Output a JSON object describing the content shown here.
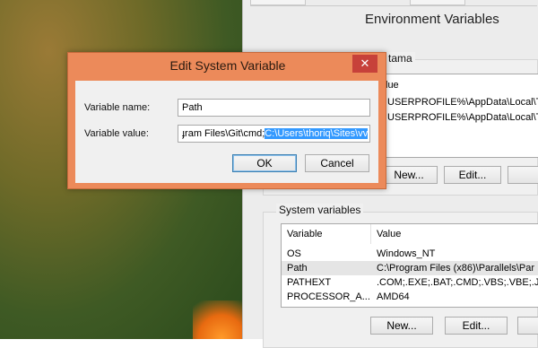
{
  "env_window": {
    "title": "Environment Variables",
    "user_group_label": "tama",
    "user_list": {
      "column_value": "lue",
      "rows": [
        "USERPROFILE%\\AppData\\Local\\Ter",
        "USERPROFILE%\\AppData\\Local\\Ter"
      ]
    },
    "user_buttons": {
      "new": "New...",
      "edit": "Edit...",
      "delete": ""
    },
    "system_group_label": "System variables",
    "system_list": {
      "columns": {
        "variable": "Variable",
        "value": "Value"
      },
      "rows": [
        {
          "variable": "OS",
          "value": "Windows_NT"
        },
        {
          "variable": "Path",
          "value": "C:\\Program Files (x86)\\Parallels\\Par"
        },
        {
          "variable": "PATHEXT",
          "value": ".COM;.EXE;.BAT;.CMD;.VBS;.VBE;.JS"
        },
        {
          "variable": "PROCESSOR_A...",
          "value": "AMD64"
        }
      ]
    },
    "system_buttons": {
      "new": "New...",
      "edit": "Edit...",
      "delete": ""
    }
  },
  "edit_dialog": {
    "title": "Edit System Variable",
    "close_glyph": "✕",
    "name_label": "Variable name:",
    "name_value": "Path",
    "value_label": "Variable value:",
    "value_before": "ɟram Files\\Git\\cmd;",
    "value_selected": "C:\\Users\\thoriq\\Sites\\vv",
    "ok_label": "OK",
    "cancel_label": "Cancel"
  },
  "colors": {
    "dialog_frame": "#ec8a5a",
    "close_button": "#c7413a",
    "selection": "#3399ff",
    "window_bg": "#f0f0f0"
  }
}
